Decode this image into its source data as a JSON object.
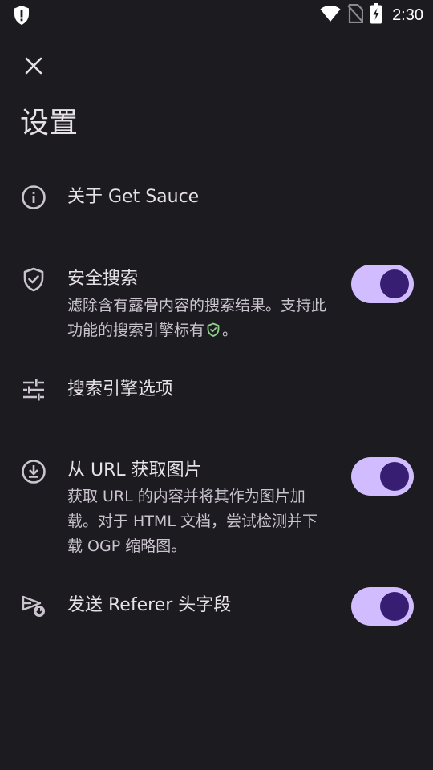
{
  "status_bar": {
    "time": "2:30",
    "icons": [
      "shield-alert-icon",
      "wifi-icon",
      "no-sim-icon",
      "battery-charging-icon"
    ]
  },
  "header": {
    "close_icon": "close-icon",
    "title": "设置"
  },
  "settings": [
    {
      "id": "about",
      "icon": "info-icon",
      "title": "关于 Get Sauce"
    },
    {
      "id": "safe-search",
      "icon": "shield-check-icon",
      "title": "安全搜索",
      "description_prefix": "滤除含有露骨内容的搜索结果。支持此功能的搜索引擎标有",
      "description_suffix": "。",
      "toggle_on": true
    },
    {
      "id": "search-engine-options",
      "icon": "tune-icon",
      "title": "搜索引擎选项"
    },
    {
      "id": "fetch-image-from-url",
      "icon": "download-circle-icon",
      "title": "从 URL 获取图片",
      "description": "获取 URL 的内容并将其作为图片加载。对于 HTML 文档，尝试检测并下载 OGP 缩略图。",
      "toggle_on": true
    },
    {
      "id": "send-referer",
      "icon": "send-download-icon",
      "title": "发送 Referer 头字段",
      "toggle_on": true
    }
  ],
  "colors": {
    "background": "#1c1b20",
    "toggle_track": "#d0bcff",
    "toggle_thumb": "#381e72",
    "safe_badge": "#8fd18a"
  }
}
